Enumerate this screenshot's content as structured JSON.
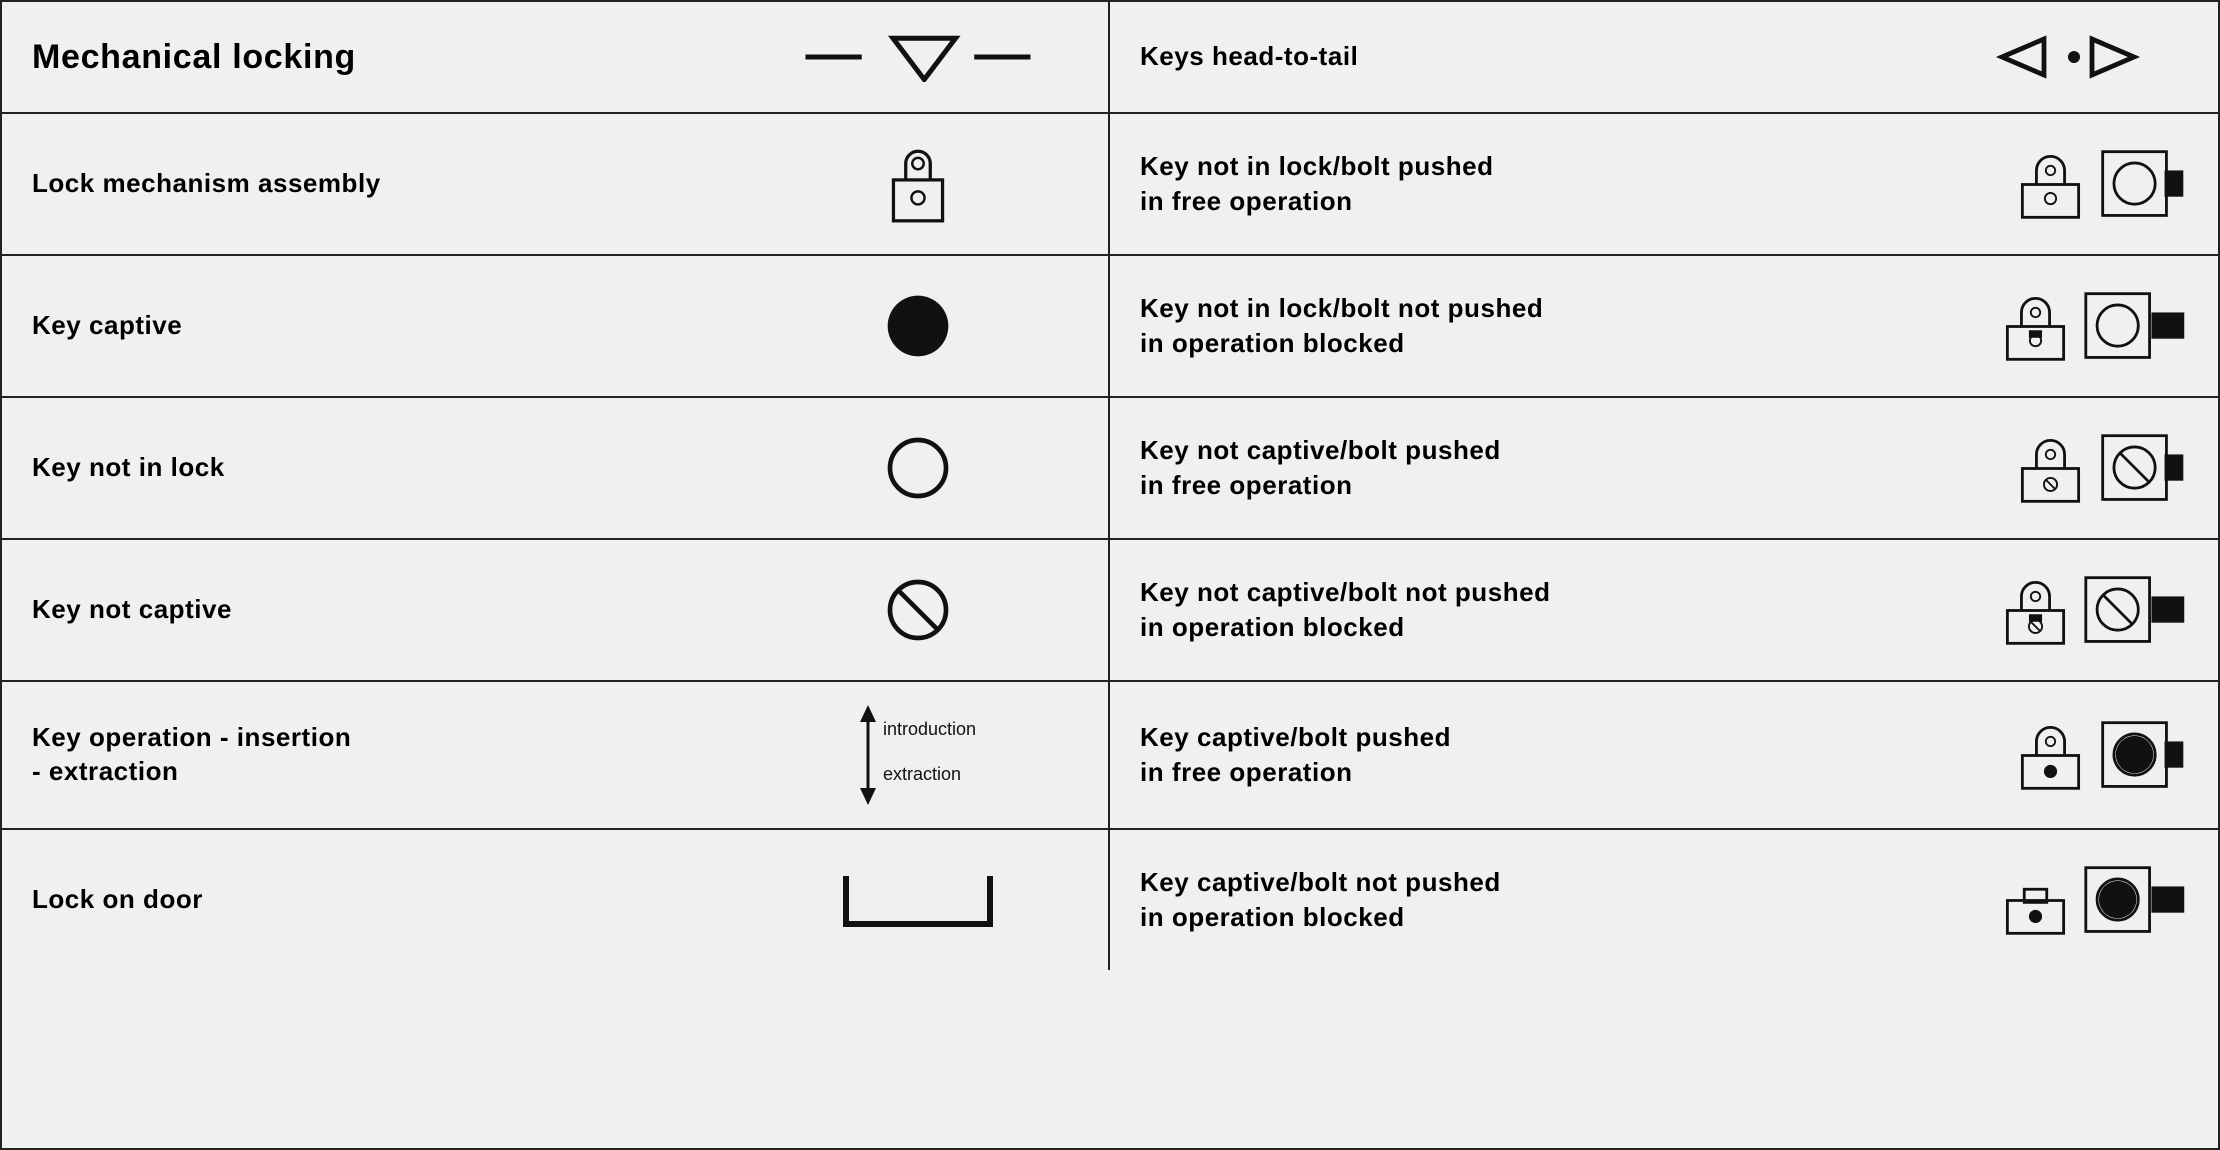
{
  "rows": [
    {
      "id": "header",
      "left_label": "Mechanical locking",
      "right_label": "Keys head-to-tail",
      "left_icon": "mechanical-locking",
      "right_icons": "keys-head-to-tail"
    },
    {
      "id": "lock-mechanism",
      "left_label": "Lock mechanism assembly",
      "right_label": "Key not in lock/bolt pushed\nin free operation",
      "left_icon": "lock-mechanism",
      "right_icons": "key-not-in-lock-bolt-pushed-free"
    },
    {
      "id": "key-captive",
      "left_label": "Key captive",
      "right_label": "Key not in lock/bolt not pushed\nin operation blocked",
      "left_icon": "key-captive",
      "right_icons": "key-not-in-lock-bolt-not-pushed-blocked"
    },
    {
      "id": "key-not-in-lock",
      "left_label": "Key not in lock",
      "right_label": "Key not captive/bolt pushed\nin free operation",
      "left_icon": "key-not-in-lock",
      "right_icons": "key-not-captive-bolt-pushed-free"
    },
    {
      "id": "key-not-captive",
      "left_label": "Key not captive",
      "right_label": "Key not captive/bolt not pushed\nin operation blocked",
      "left_icon": "key-not-captive",
      "right_icons": "key-not-captive-bolt-not-pushed-blocked"
    },
    {
      "id": "key-operation",
      "left_label": "Key operation  - insertion\n              - extraction",
      "right_label": "Key captive/bolt pushed\nin free operation",
      "left_icon": "key-operation",
      "right_icons": "key-captive-bolt-pushed-free"
    },
    {
      "id": "lock-on-door",
      "left_label": "Lock on door",
      "right_label": "Key captive/bolt not pushed\nin operation blocked",
      "left_icon": "lock-on-door",
      "right_icons": "key-captive-bolt-not-pushed-blocked"
    }
  ]
}
